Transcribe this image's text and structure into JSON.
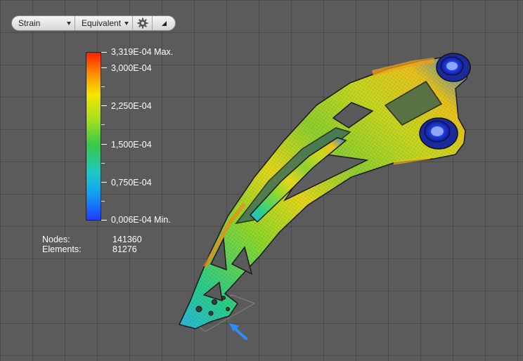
{
  "toolbar": {
    "result_type": "Strain",
    "component": "Equivalent"
  },
  "legend": {
    "max_label": "3,319E-04 Max.",
    "labels": [
      "3,000E-04",
      "2,250E-04",
      "1,500E-04",
      "0,750E-04"
    ],
    "min_label": "0,006E-04 Min.",
    "max_color": "#ff1e00",
    "min_color": "#1f3cff"
  },
  "mesh_stats": {
    "nodes_label": "Nodes:",
    "nodes_value": "141360",
    "elements_label": "Elements:",
    "elements_value": "81276"
  },
  "icons": {
    "settings": "gear-icon",
    "panel_toggle": "triangle-icon",
    "load_arrow": "arrow-icon"
  }
}
